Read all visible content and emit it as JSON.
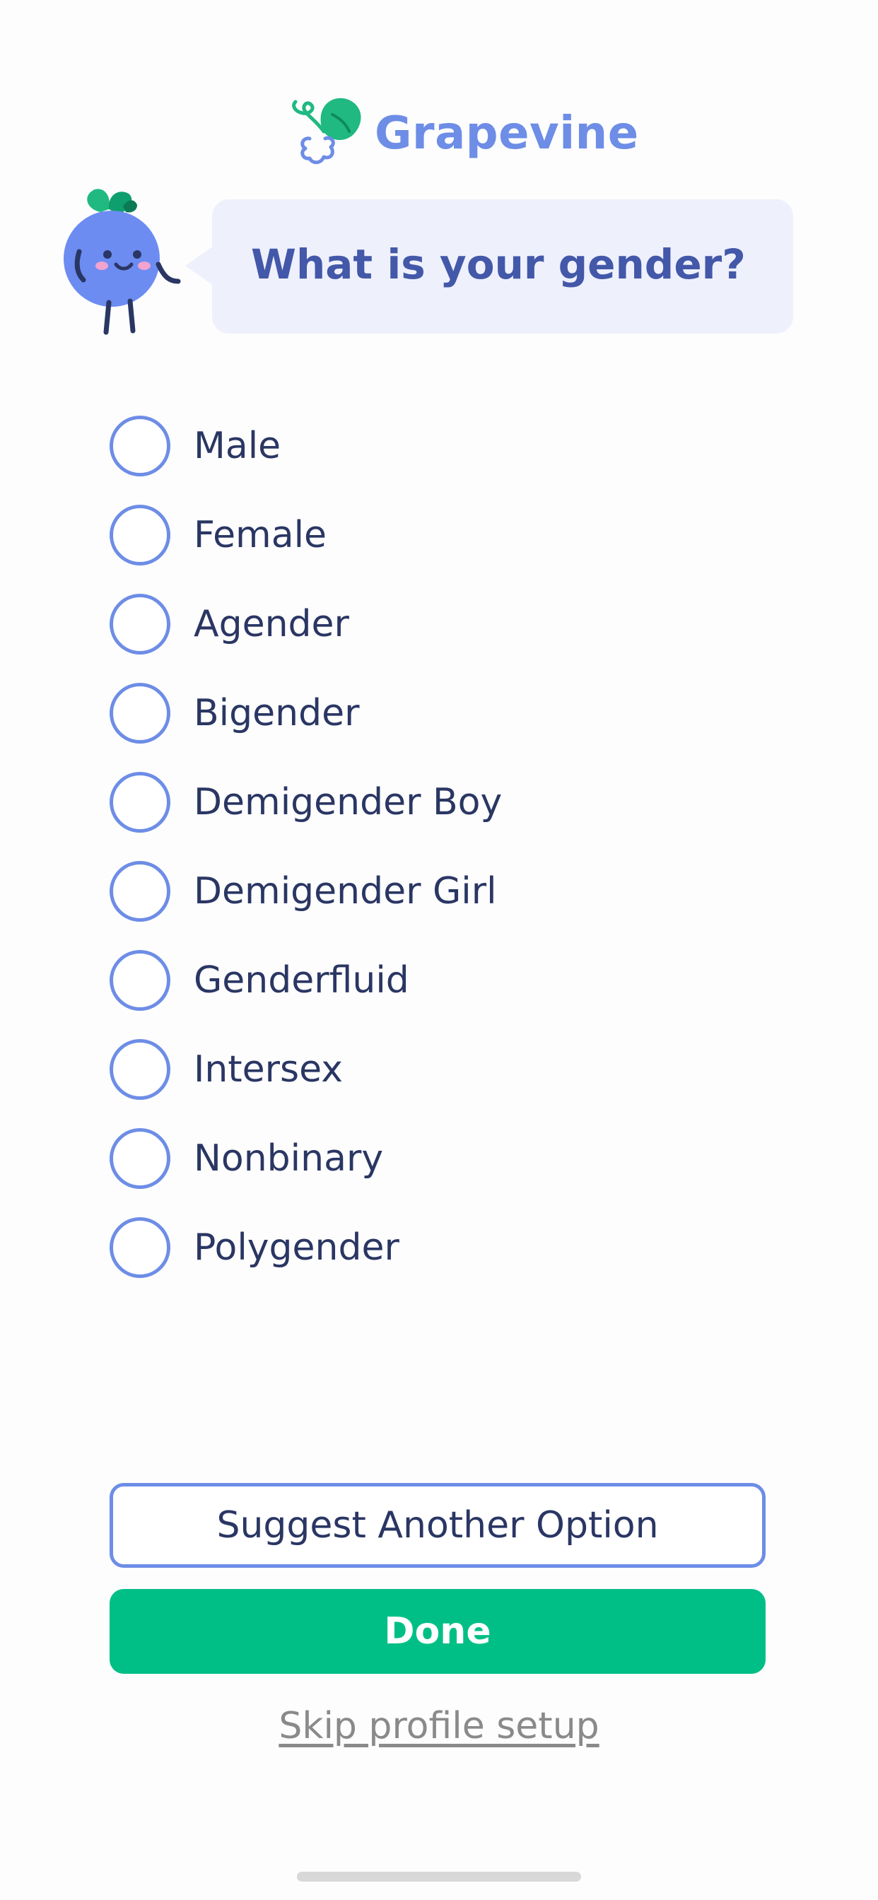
{
  "app": {
    "brand_name": "Grapevine",
    "brand_color": "#6d8de6",
    "accent_green": "#00bf86"
  },
  "prompt": {
    "question": "What is your gender?"
  },
  "options": [
    {
      "label": "Male",
      "selected": false
    },
    {
      "label": "Female",
      "selected": false
    },
    {
      "label": "Agender",
      "selected": false
    },
    {
      "label": "Bigender",
      "selected": false
    },
    {
      "label": "Demigender Boy",
      "selected": false
    },
    {
      "label": "Demigender Girl",
      "selected": false
    },
    {
      "label": "Genderfluid",
      "selected": false
    },
    {
      "label": "Intersex",
      "selected": false
    },
    {
      "label": "Nonbinary",
      "selected": false
    },
    {
      "label": "Polygender",
      "selected": false
    }
  ],
  "actions": {
    "suggest_label": "Suggest Another Option",
    "done_label": "Done",
    "skip_label": "Skip profile setup"
  },
  "icons": {
    "logo": "grapevine-logo-icon",
    "mascot": "blueberry-mascot-icon",
    "radio": "radio-unchecked-icon"
  }
}
